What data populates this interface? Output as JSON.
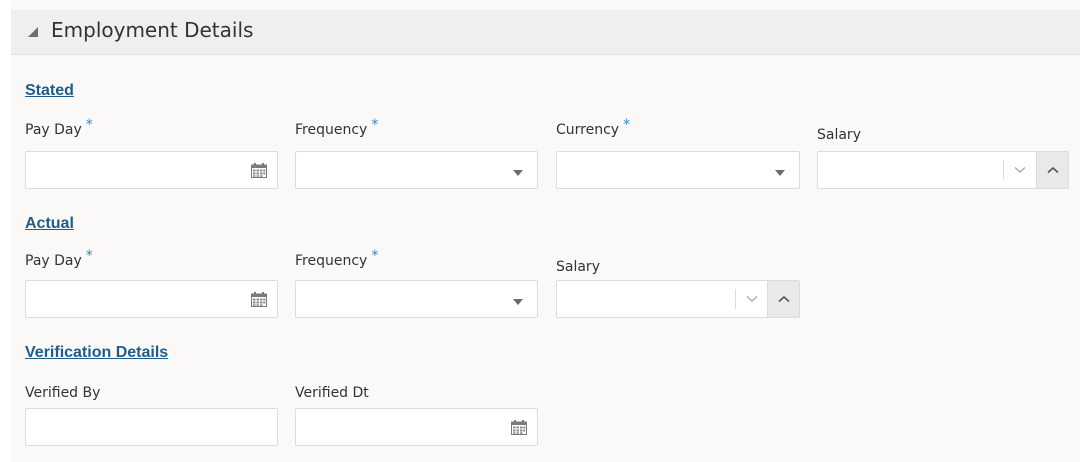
{
  "header": {
    "title": "Employment Details",
    "collapse_icon": "triangle-expanded-icon"
  },
  "stated": {
    "heading": "Stated",
    "pay_day_label": "Pay Day",
    "frequency_label": "Frequency",
    "currency_label": "Currency",
    "salary_label": "Salary",
    "required_marker": "*",
    "pay_day_value": "",
    "frequency_value": "",
    "currency_value": "",
    "salary_value": ""
  },
  "actual": {
    "heading": "Actual",
    "pay_day_label": "Pay Day",
    "frequency_label": "Frequency",
    "salary_label": "Salary",
    "required_marker": "*",
    "pay_day_value": "",
    "frequency_value": "",
    "salary_value": ""
  },
  "verification": {
    "heading": "Verification Details",
    "verified_by_label": "Verified By",
    "verified_dt_label": "Verified Dt",
    "verified_by_value": "",
    "verified_dt_value": ""
  },
  "colors": {
    "accent": "#1e5d8a",
    "required": "#2f86c7",
    "panel_bg": "#fbf9f8",
    "header_bg": "#f1efed"
  }
}
